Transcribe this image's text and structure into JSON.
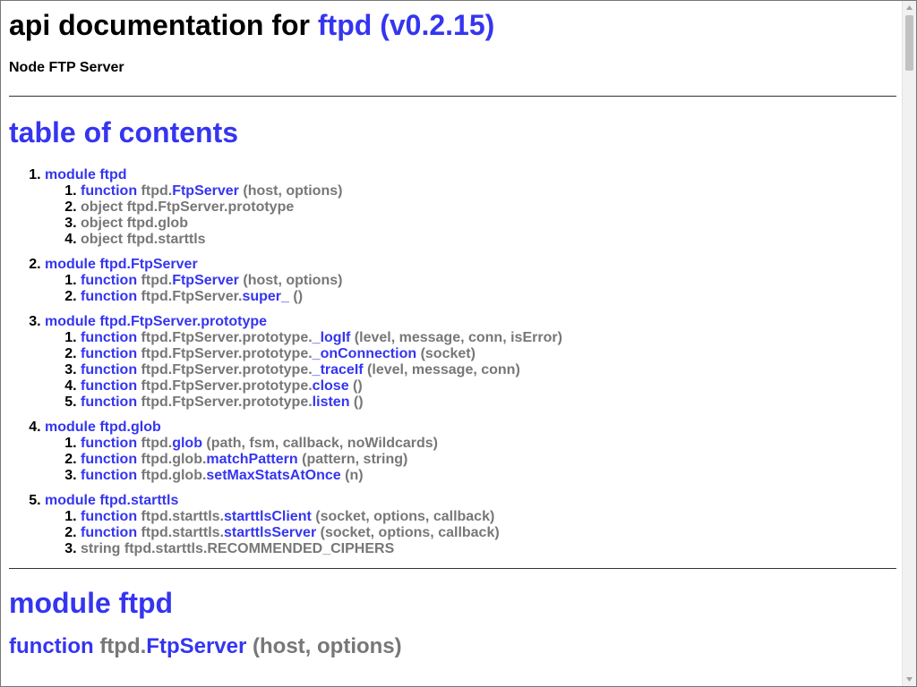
{
  "doc": {
    "title_prefix": "api documentation for ",
    "title_link": "ftpd (v0.2.15)",
    "subtitle": "Node FTP Server"
  },
  "toc": {
    "title": "table of contents",
    "modules": [
      {
        "label": "module ftpd",
        "items": [
          {
            "kind": "function",
            "prefix": "ftpd.",
            "name": "FtpServer",
            "args": "(host, options)"
          },
          {
            "kind": "",
            "plain": "object ftpd.FtpServer.prototype"
          },
          {
            "kind": "",
            "plain": "object ftpd.glob"
          },
          {
            "kind": "",
            "plain": "object ftpd.starttls"
          }
        ]
      },
      {
        "label": "module ftpd.FtpServer",
        "items": [
          {
            "kind": "function",
            "prefix": "ftpd.",
            "name": "FtpServer",
            "args": "(host, options)"
          },
          {
            "kind": "function",
            "prefix": "ftpd.FtpServer.",
            "name": "super_",
            "args": "()"
          }
        ]
      },
      {
        "label": "module ftpd.FtpServer.prototype",
        "items": [
          {
            "kind": "function",
            "prefix": "ftpd.FtpServer.prototype.",
            "name": "_logIf",
            "args": "(level, message, conn, isError)"
          },
          {
            "kind": "function",
            "prefix": "ftpd.FtpServer.prototype.",
            "name": "_onConnection",
            "args": "(socket)"
          },
          {
            "kind": "function",
            "prefix": "ftpd.FtpServer.prototype.",
            "name": "_traceIf",
            "args": "(level, message, conn)"
          },
          {
            "kind": "function",
            "prefix": "ftpd.FtpServer.prototype.",
            "name": "close",
            "args": "()"
          },
          {
            "kind": "function",
            "prefix": "ftpd.FtpServer.prototype.",
            "name": "listen",
            "args": "()"
          }
        ]
      },
      {
        "label": "module ftpd.glob",
        "items": [
          {
            "kind": "function",
            "prefix": "ftpd.",
            "name": "glob",
            "args": "(path, fsm, callback, noWildcards)"
          },
          {
            "kind": "function",
            "prefix": "ftpd.glob.",
            "name": "matchPattern",
            "args": "(pattern, string)"
          },
          {
            "kind": "function",
            "prefix": "ftpd.glob.",
            "name": "setMaxStatsAtOnce",
            "args": "(n)"
          }
        ]
      },
      {
        "label": "module ftpd.starttls",
        "items": [
          {
            "kind": "function",
            "prefix": "ftpd.starttls.",
            "name": "starttlsClient",
            "args": "(socket, options, callback)"
          },
          {
            "kind": "function",
            "prefix": "ftpd.starttls.",
            "name": "starttlsServer",
            "args": "(socket, options, callback)"
          },
          {
            "kind": "",
            "plain": "string ftpd.starttls.RECOMMENDED_CIPHERS"
          }
        ]
      }
    ]
  },
  "section": {
    "module_title": "module ftpd",
    "fn_kind": "function",
    "fn_prefix": "ftpd.",
    "fn_name": "FtpServer",
    "fn_args": "(host, options)"
  },
  "colors": {
    "link": "#3535f0",
    "muted": "#777777",
    "text": "#000000"
  },
  "icons": {
    "scroll_up": "triangle-up-icon",
    "scroll_down": "triangle-down-icon"
  }
}
